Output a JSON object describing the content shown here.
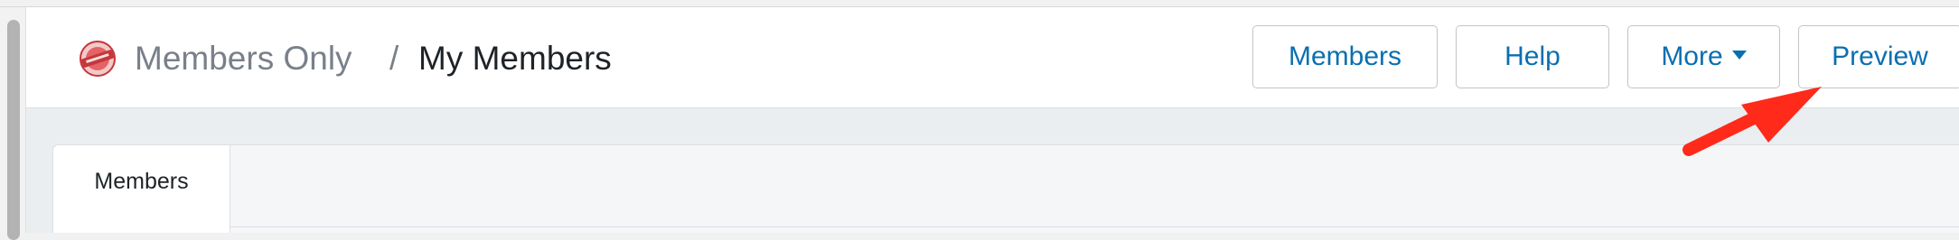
{
  "header": {
    "breadcrumb": {
      "parent": "Members Only",
      "separator": "/",
      "current": "My Members"
    },
    "logo_icon": "members-only-logo",
    "buttons": {
      "members": "Members",
      "help": "Help",
      "more": "More",
      "preview": "Preview"
    }
  },
  "tabs": [
    {
      "label": "Members",
      "active": true
    }
  ],
  "annotation": {
    "type": "red-arrow",
    "color": "#ff2a1a",
    "points_to": "preview-button"
  },
  "colors": {
    "accent": "#0a6fb0",
    "page_background": "#ebeef0",
    "breadcrumb_muted": "#79808a"
  }
}
